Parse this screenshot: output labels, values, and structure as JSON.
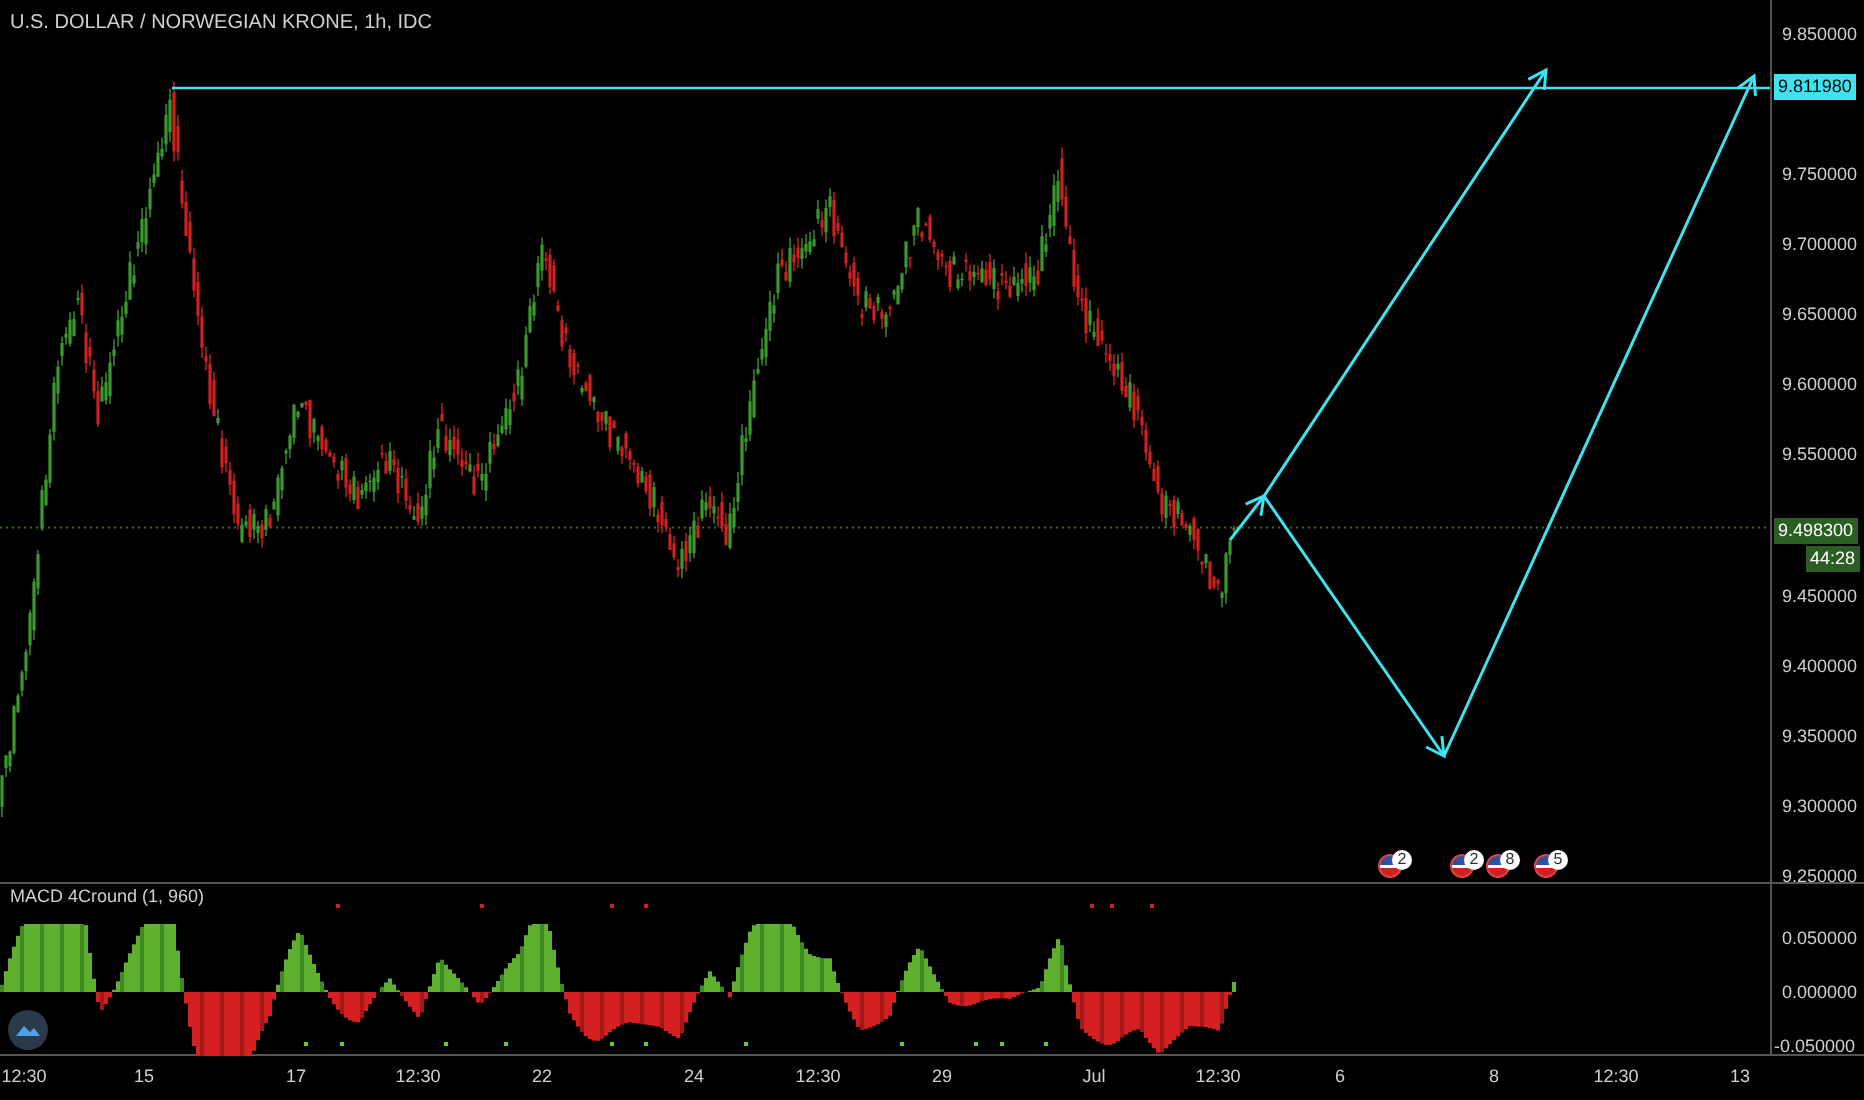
{
  "chart": {
    "title": "U.S. DOLLAR / NORWEGIAN KRONE, 1h, IDC",
    "price_axis": [
      "9.850000",
      "9.750000",
      "9.700000",
      "9.650000",
      "9.600000",
      "9.550000",
      "9.450000",
      "9.400000",
      "9.350000",
      "9.300000",
      "9.250000"
    ],
    "target_price": "9.811980",
    "last_price": "9.498300",
    "countdown": "44:28",
    "events": [
      {
        "count": "2"
      },
      {
        "count": "2"
      },
      {
        "count": "8"
      },
      {
        "count": "5"
      }
    ]
  },
  "indicator": {
    "title": "MACD 4Cround (1, 960)",
    "axis": [
      "0.050000",
      "0.000000",
      "-0.050000"
    ]
  },
  "time_axis": [
    "12:30",
    "15",
    "17",
    "12:30",
    "22",
    "24",
    "12:30",
    "29",
    "Jul",
    "12:30",
    "6",
    "8",
    "12:30",
    "13"
  ]
}
